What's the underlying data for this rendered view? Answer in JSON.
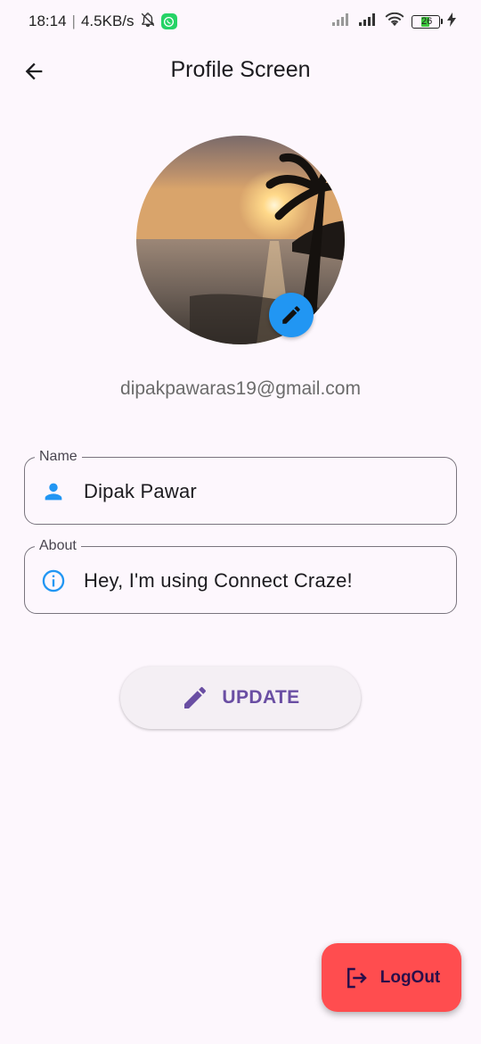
{
  "status_bar": {
    "time": "18:14",
    "speed": "4.5KB/s",
    "battery": "26",
    "icons": [
      "mute-bell-icon",
      "whatsapp-icon",
      "signal-icon",
      "signal-icon",
      "wifi-icon",
      "battery-icon",
      "charging-bolt-icon"
    ]
  },
  "app_bar": {
    "title": "Profile Screen",
    "back_icon": "arrow-back-icon"
  },
  "profile": {
    "email": "dipakpawaras19@gmail.com",
    "avatar_edit_icon": "pencil-icon"
  },
  "fields": {
    "name": {
      "label": "Name",
      "value": "Dipak Pawar",
      "icon": "person-icon"
    },
    "about": {
      "label": "About",
      "value": "Hey, I'm using Connect Craze!",
      "icon": "info-icon"
    }
  },
  "update_button": {
    "label": "UPDATE",
    "icon": "pencil-icon"
  },
  "logout_button": {
    "label": "LogOut",
    "icon": "logout-icon"
  },
  "colors": {
    "background": "#fdf7fd",
    "accent_blue": "#2196f3",
    "update_text": "#6a4ea3",
    "logout_bg": "#ff4d4f"
  }
}
